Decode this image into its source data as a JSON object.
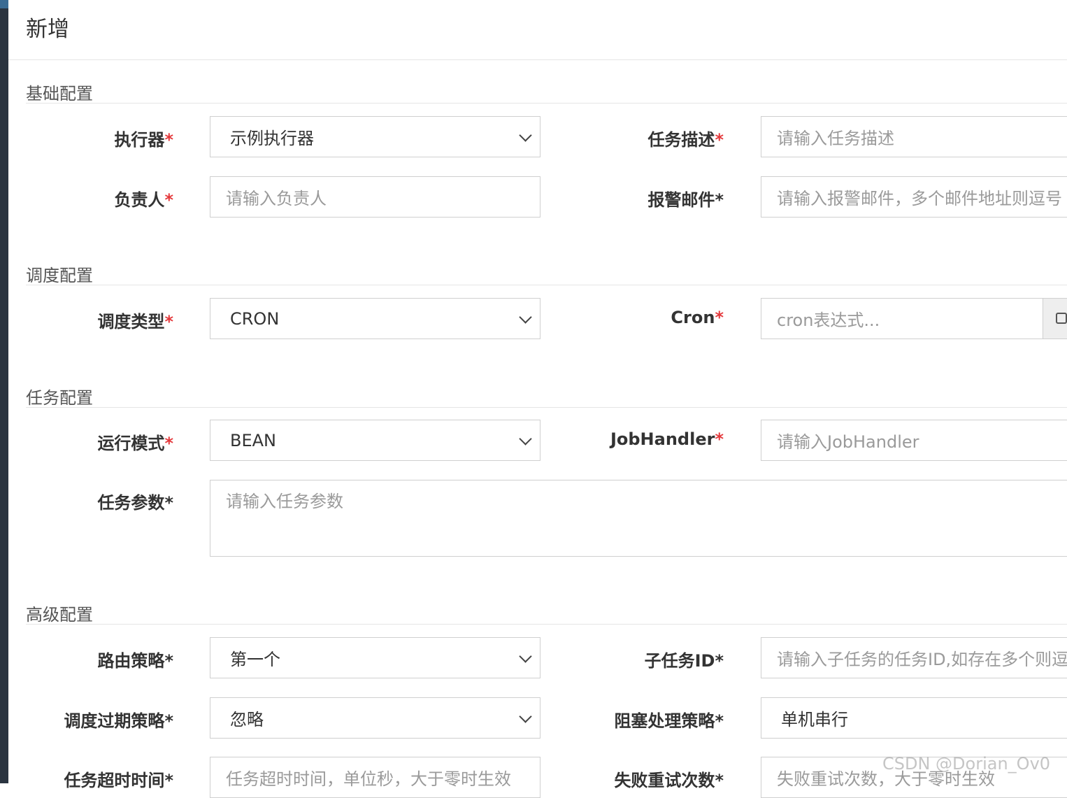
{
  "dialog": {
    "title": "新增"
  },
  "sections": {
    "basic": "基础配置",
    "schedule": "调度配置",
    "task": "任务配置",
    "advanced": "高级配置"
  },
  "fields": {
    "executor": {
      "label": "执行器",
      "value": "示例执行器"
    },
    "job_desc": {
      "label": "任务描述",
      "placeholder": "请输入任务描述"
    },
    "author": {
      "label": "负责人",
      "placeholder": "请输入负责人"
    },
    "alarm_email": {
      "label": "报警邮件",
      "placeholder": "请输入报警邮件，多个邮件地址则逗号"
    },
    "schedule_type": {
      "label": "调度类型",
      "value": "CRON"
    },
    "cron": {
      "label": "Cron",
      "placeholder": "cron表达式..."
    },
    "glue_type": {
      "label": "运行模式",
      "value": "BEAN"
    },
    "job_handler": {
      "label": "JobHandler",
      "placeholder": "请输入JobHandler"
    },
    "job_param": {
      "label": "任务参数",
      "placeholder": "请输入任务参数"
    },
    "route_strategy": {
      "label": "路由策略",
      "value": "第一个"
    },
    "child_job_id": {
      "label": "子任务ID",
      "placeholder": "请输入子任务的任务ID,如存在多个则逗"
    },
    "misfire_strategy": {
      "label": "调度过期策略",
      "value": "忽略"
    },
    "block_strategy": {
      "label": "阻塞处理策略",
      "value": "单机串行"
    },
    "timeout": {
      "label": "任务超时时间",
      "placeholder": "任务超时时间，单位秒，大于零时生效"
    },
    "fail_retry": {
      "label": "失败重试次数",
      "placeholder": "失败重试次数，大于零时生效"
    }
  },
  "required_mark": "*",
  "watermark": "CSDN @Dorian_Ov0",
  "colors": {
    "required_red": "#e4393c",
    "border": "#cfcfcf",
    "placeholder": "#9a9a9a"
  }
}
